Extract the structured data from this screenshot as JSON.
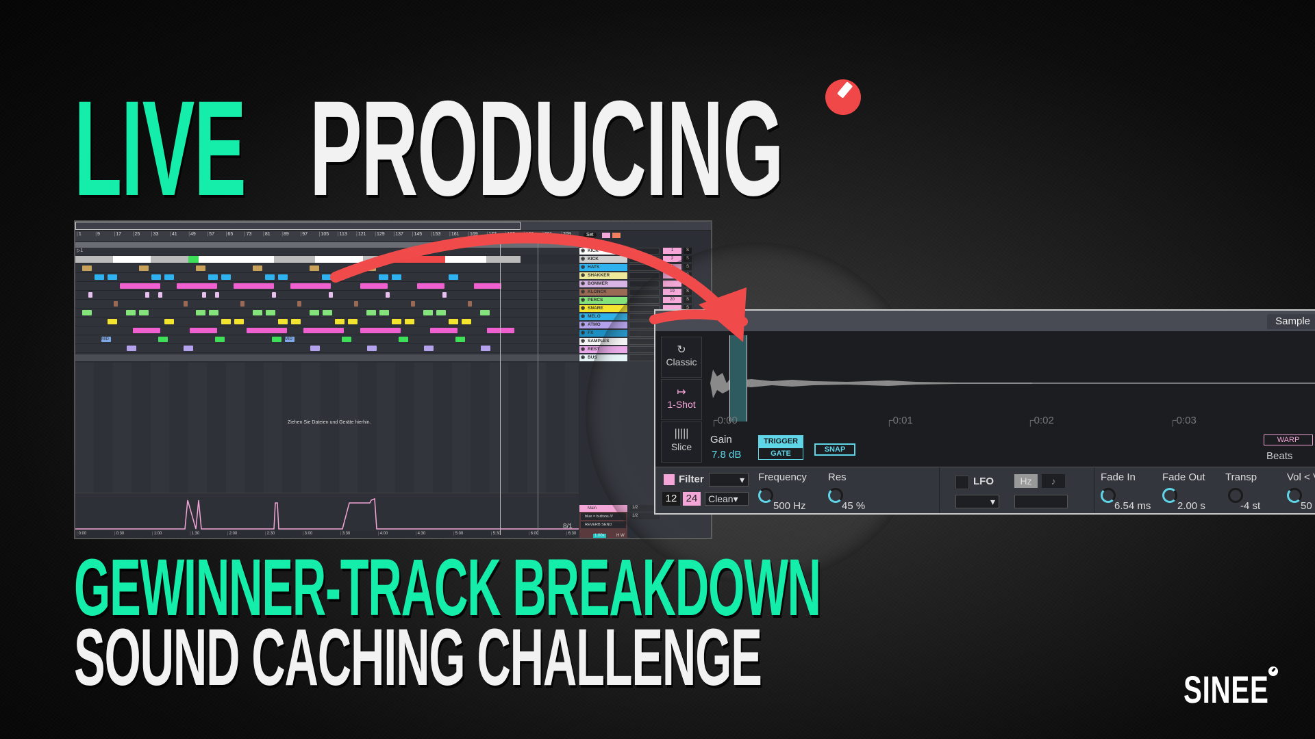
{
  "headline": {
    "line1_accent": "LIVE",
    "line1_main": "PRODUCING",
    "line2_accent": "GEWINNER-TRACK BREAKDOWN",
    "line3_main": "SOUND CACHING CHALLENGE"
  },
  "brand": {
    "name": "SINEE",
    "accent_color": "#14eeaa",
    "logo_color": "#f04848"
  },
  "daw": {
    "bar_numbers": [
      "1",
      "9",
      "17",
      "25",
      "33",
      "41",
      "49",
      "57",
      "65",
      "73",
      "81",
      "89",
      "97",
      "105",
      "113",
      "121",
      "129",
      "137",
      "145",
      "153",
      "161",
      "169",
      "177",
      "185",
      "193",
      "201",
      "209"
    ],
    "locator": "1",
    "set_label": "Set",
    "drop_hint": "Ziehen Sie Dateien und Geräte hierhin.",
    "time_signature": "8/1",
    "time_ticks": [
      "0:00",
      "0:30",
      "1:00",
      "1:30",
      "2:00",
      "2:30",
      "3:00",
      "3:30",
      "4:00",
      "4:30",
      "5:00",
      "5:30",
      "6:00",
      "6:30"
    ],
    "tracks": [
      {
        "name": "KICK",
        "color": "#ffffff",
        "number": "1"
      },
      {
        "name": "KICK",
        "color": "#d0d0d0",
        "number": "2"
      },
      {
        "name": "HATS",
        "color": "#2fb3f0",
        "number": "8"
      },
      {
        "name": "SHAKKER",
        "color": "#eee99a",
        "number": ""
      },
      {
        "name": "BOMMER",
        "color": "#d7b4e3",
        "number": ""
      },
      {
        "name": "KLONCK",
        "color": "#9b6a55",
        "number": "19"
      },
      {
        "name": "PERCS",
        "color": "#84e37a",
        "number": "20"
      },
      {
        "name": "SNARE",
        "color": "#f3e430",
        "number": ""
      },
      {
        "name": "MELO",
        "color": "#30b0e8",
        "number": ""
      },
      {
        "name": "ATMO",
        "color": "#b5a2ec",
        "number": ""
      },
      {
        "name": "FX",
        "color": "#1c8ec2",
        "number": ""
      },
      {
        "name": "SAMPLES",
        "color": "#f4f4f4",
        "number": ""
      },
      {
        "name": "REST",
        "color": "#e8a7e8",
        "number": ""
      },
      {
        "name": "BUS",
        "color": "#e6f3f7",
        "number": ""
      }
    ],
    "solo_label": "S",
    "main_track": {
      "name": "Main",
      "sends": [
        "blue = buttons ///",
        "REVERB SEND"
      ],
      "routing": [
        "1/2",
        "1/2"
      ]
    },
    "zoom_value": "1.00x",
    "hw_buttons": [
      "H",
      "W"
    ],
    "clip_label": "MID"
  },
  "simpler": {
    "tab": "Sample",
    "modes": [
      {
        "label": "Classic",
        "icon": "loop-icon",
        "active": false
      },
      {
        "label": "1-Shot",
        "icon": "one-shot-icon",
        "active": true
      },
      {
        "label": "Slice",
        "icon": "slice-icon",
        "active": false
      }
    ],
    "time_marks": [
      "0:00",
      "0:01",
      "0:02",
      "0:03"
    ],
    "gain_label": "Gain",
    "gain_value": "7.8 dB",
    "trigger_label": "TRIGGER",
    "gate_label": "GATE",
    "snap_label": "SNAP",
    "warp_label": "WARP",
    "warp_mode": "Beats",
    "filter": {
      "label": "Filter",
      "slopes": [
        "12",
        "24"
      ],
      "active_slope": "24",
      "type": "Clean",
      "enabled": true
    },
    "frequency": {
      "label": "Frequency",
      "value": "500 Hz"
    },
    "res": {
      "label": "Res",
      "value": "45 %"
    },
    "lfo": {
      "label": "LFO",
      "hz_label": "Hz",
      "note_label": "♪",
      "enabled": false
    },
    "fade_in": {
      "label": "Fade In",
      "value": "6.54 ms"
    },
    "fade_out": {
      "label": "Fade Out",
      "value": "2.00 s"
    },
    "transp": {
      "label": "Transp",
      "value": "-4 st"
    },
    "vol": {
      "label": "Vol < V",
      "value": "50"
    }
  }
}
